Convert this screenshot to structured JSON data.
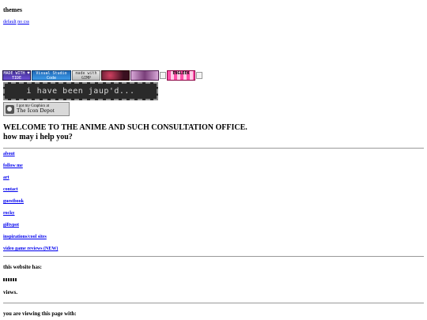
{
  "themes": {
    "heading": "themes",
    "links": [
      "default",
      "no css"
    ]
  },
  "badges": [
    {
      "name": "badge-1",
      "label": "MADE WITH ♥ TIDE"
    },
    {
      "name": "badge-vscode",
      "label": "Visual Studio Code"
    },
    {
      "name": "badge-gimp",
      "label": "made with GIMP"
    },
    {
      "name": "badge-4",
      "label": ""
    },
    {
      "name": "badge-5",
      "label": ""
    },
    {
      "name": "badge-6",
      "label": "ENGLEEK"
    }
  ],
  "jaup_banner": "i have been jaup'd...",
  "icon_depot": {
    "line1": "I got my Graphics at",
    "line2": "The Icon Depot"
  },
  "welcome": {
    "heading": "WELCOME TO THE ANIME AND SUCH CONSULTATION OFFICE.",
    "subheading": "how may i help you?"
  },
  "nav": [
    "about",
    "follow me",
    "art",
    "contact",
    "guestbook",
    "rocky",
    "giftypot",
    "inspirations/cool sites",
    "video game reviews (NEW)"
  ],
  "stats": {
    "site_has": "this website has:",
    "views_suffix": "views.",
    "viewing_with": "you are viewing this page with:"
  }
}
